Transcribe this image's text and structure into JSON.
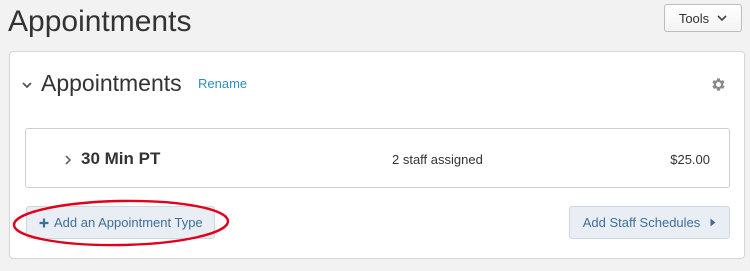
{
  "page": {
    "title": "Appointments"
  },
  "toolbar": {
    "tools_label": "Tools"
  },
  "section": {
    "title": "Appointments",
    "rename_label": "Rename"
  },
  "appointment_types": [
    {
      "name": "30 Min PT",
      "staff": "2 staff assigned",
      "price": "$25.00"
    }
  ],
  "actions": {
    "add_type_label": "Add an Appointment Type",
    "add_staff_label": "Add Staff Schedules"
  },
  "icons": {
    "tools_dropdown": "chevron-down-icon",
    "section_toggle": "chevron-down-icon",
    "settings": "gear-icon",
    "row_expand": "chevron-right-icon",
    "add": "plus-icon",
    "add_staff_arrow": "caret-right-icon"
  },
  "colors": {
    "link": "#2a8fbd",
    "action_button_bg": "#e8eef4",
    "action_button_text": "#3f6f98",
    "annotation_circle": "#e0001b"
  }
}
